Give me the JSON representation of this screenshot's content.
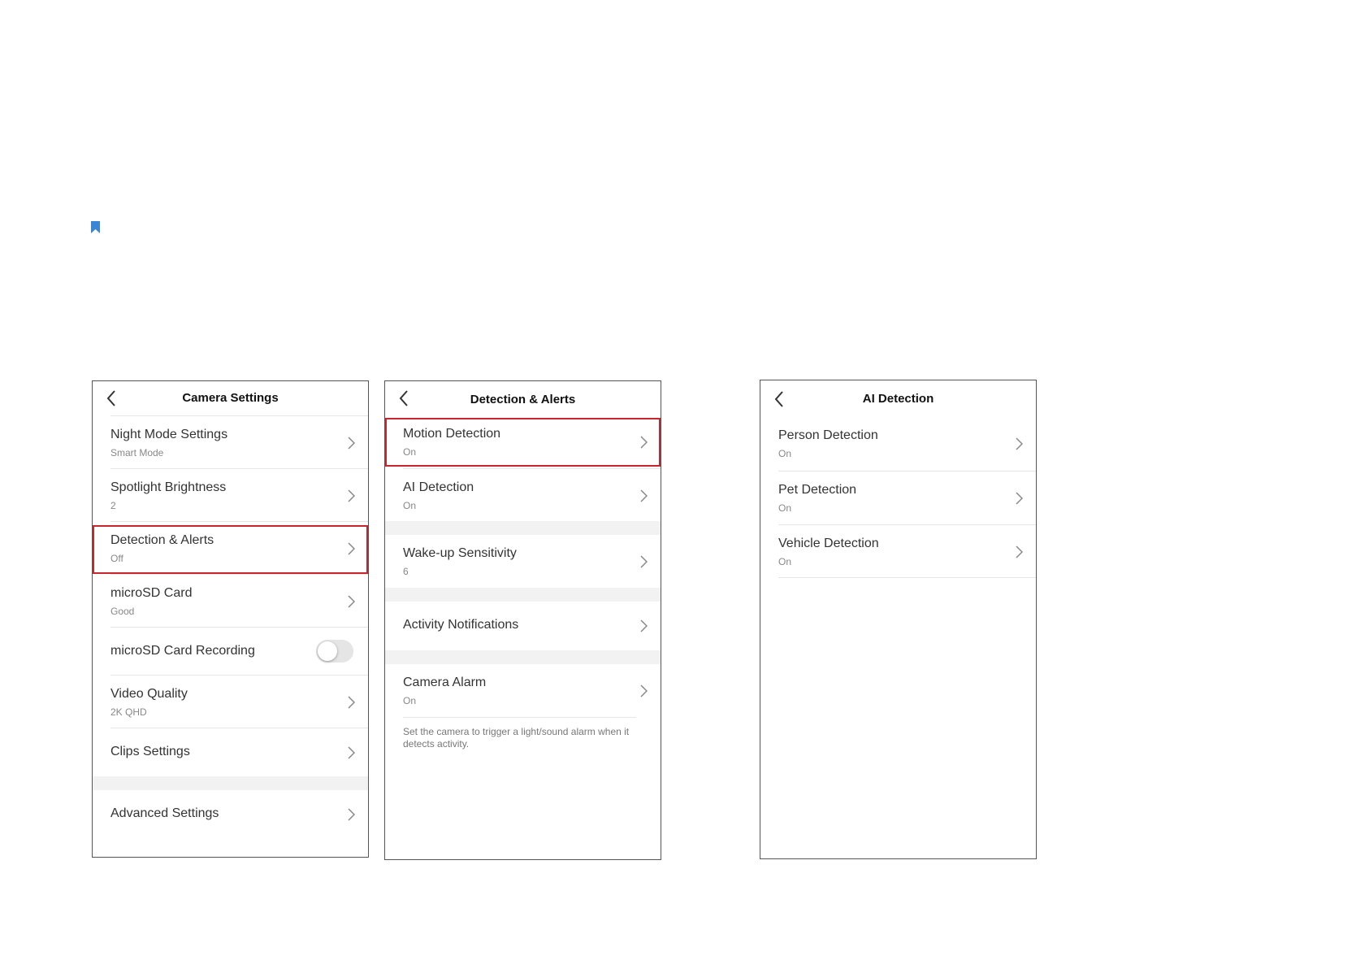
{
  "colors": {
    "highlight": "#c9252c",
    "bookmark": "#3a86d4"
  },
  "screen1": {
    "title": "Camera Settings",
    "rows": [
      {
        "label": "Night Mode Settings",
        "sub": "Smart Mode"
      },
      {
        "label": "Spotlight Brightness",
        "sub": "2"
      },
      {
        "label": "Detection & Alerts",
        "sub": "Off",
        "highlighted": true
      },
      {
        "label": "microSD Card",
        "sub": "Good"
      },
      {
        "label": "microSD Card Recording",
        "toggle": "off"
      },
      {
        "label": "Video Quality",
        "sub": "2K QHD"
      },
      {
        "label": "Clips Settings"
      },
      {
        "label": "Advanced Settings"
      }
    ]
  },
  "screen2": {
    "title": "Detection & Alerts",
    "rows": [
      {
        "label": "Motion Detection",
        "sub": "On",
        "highlighted": true
      },
      {
        "label": "AI Detection",
        "sub": "On"
      },
      {
        "label": "Wake-up Sensitivity",
        "sub": "6"
      },
      {
        "label": "Activity Notifications"
      },
      {
        "label": "Camera Alarm",
        "sub": "On"
      }
    ],
    "footnote": "Set the camera to trigger a light/sound alarm when it detects activity."
  },
  "screen3": {
    "title": "AI Detection",
    "rows": [
      {
        "label": "Person Detection",
        "sub": "On"
      },
      {
        "label": "Pet Detection",
        "sub": "On"
      },
      {
        "label": "Vehicle Detection",
        "sub": "On"
      }
    ]
  }
}
